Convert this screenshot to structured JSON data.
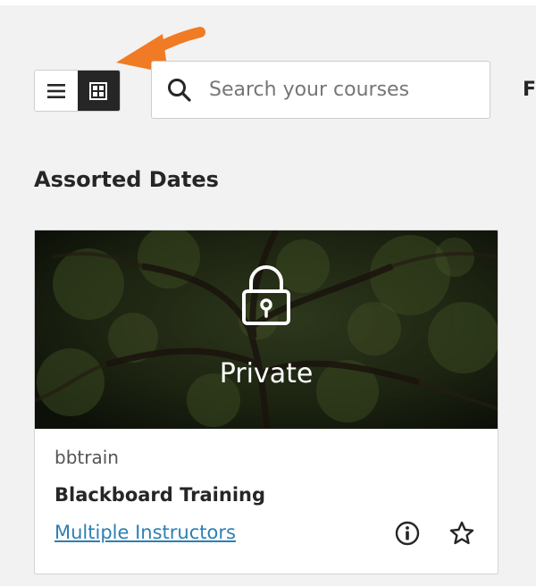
{
  "search": {
    "placeholder": "Search your courses"
  },
  "header": {
    "filter_label_cut": "Fi"
  },
  "section": {
    "title": "Assorted Dates"
  },
  "card": {
    "status_label": "Private",
    "course_id": "bbtrain",
    "course_name": "Blackboard Training",
    "instructors_link": "Multiple Instructors"
  },
  "view_toggle": {
    "active": "grid"
  },
  "icons": {
    "list_view": "list-icon",
    "grid_view": "grid-icon",
    "search": "search-icon",
    "lock": "lock-icon",
    "info": "info-icon",
    "favorite": "star-icon",
    "annotation_arrow": "arrow-icon"
  },
  "colors": {
    "accent_arrow": "#f07b24",
    "link": "#2d7fb3",
    "active_toggle": "#262626",
    "page_bg": "#f2f2f2"
  }
}
